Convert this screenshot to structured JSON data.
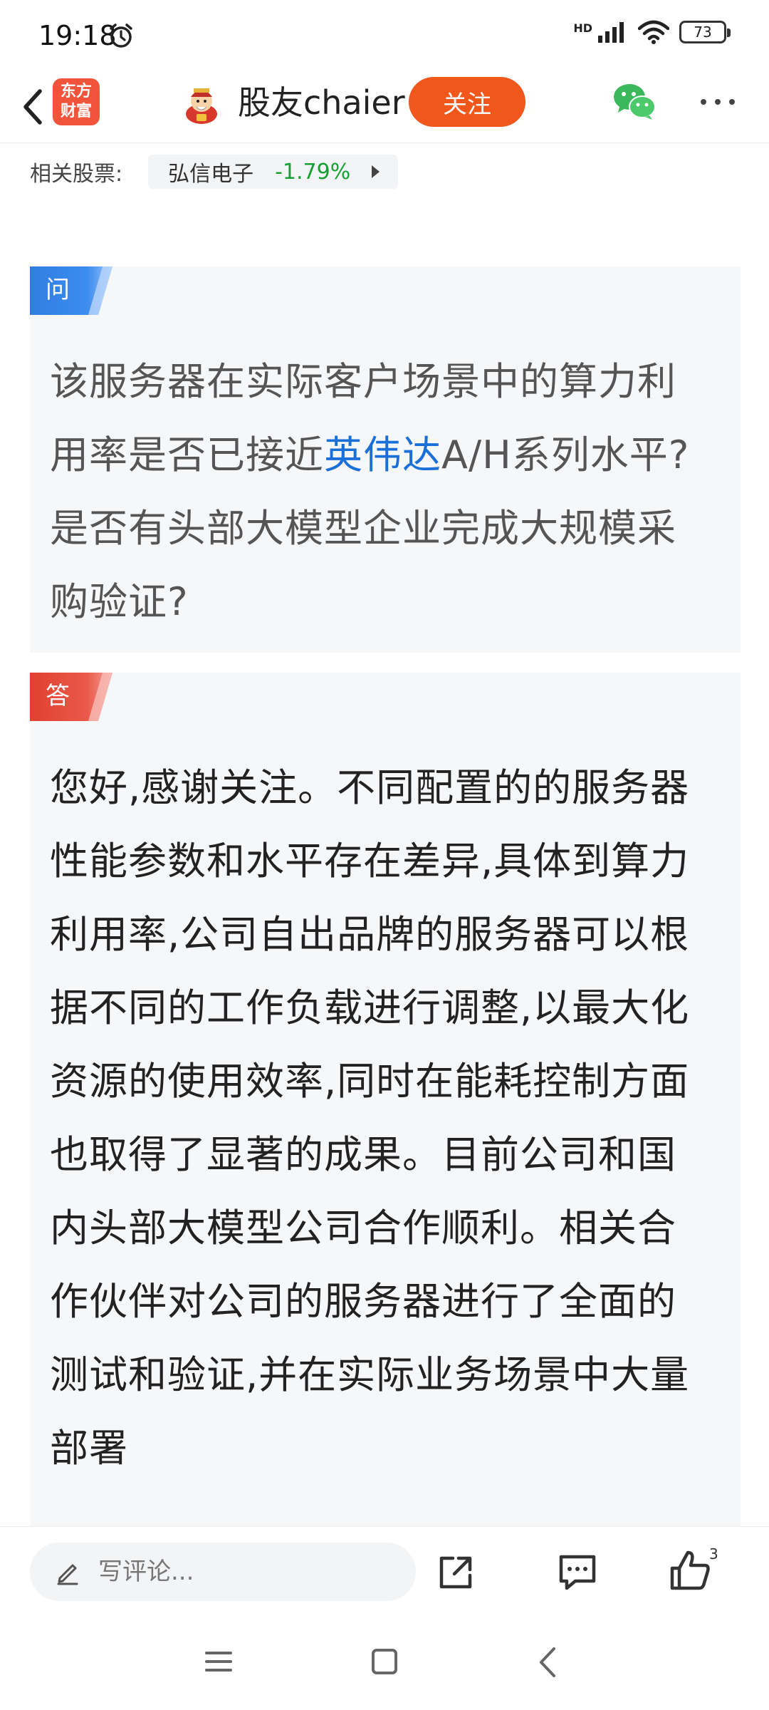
{
  "status_bar": {
    "time": "19:18",
    "network": "HD",
    "battery": "73"
  },
  "header": {
    "app_logo_line1": "东方",
    "app_logo_line2": "财富",
    "username": "股友chaier",
    "follow_label": "关注"
  },
  "related": {
    "label": "相关股票:",
    "stock_name": "弘信电子",
    "stock_change": "-1.79%",
    "change_color": "#19a035"
  },
  "question": {
    "tag": "问",
    "text_before": "该服务器在实际客户场景中的算力利用率是否已接近",
    "highlight": "英伟达",
    "text_after": "A/H系列水平?是否有头部大模型企业完成大规模采购验证?"
  },
  "answer": {
    "tag": "答",
    "text": "您好,感谢关注。不同配置的的服务器性能参数和水平存在差异,具体到算力利用率,公司自出品牌的服务器可以根据不同的工作负载进行调整,以最大化资源的使用效率,同时在能耗控制方面也取得了显著的成果。目前公司和国内头部大模型公司合作顺利。相关合作伙伴对公司的服务器进行了全面的测试和验证,并在实际业务场景中大量部署"
  },
  "bottom_bar": {
    "comment_placeholder": "写评论...",
    "like_count": "3"
  },
  "colors": {
    "accent": "#f1571b",
    "question_tag": "#2f7ee0",
    "answer_tag": "#e24a3b",
    "link": "#1a6fd8"
  },
  "icons": [
    "back-arrow-icon",
    "alarm-clock-icon",
    "signal-icon",
    "wifi-icon",
    "battery-icon",
    "wechat-icon",
    "more-icon",
    "pen-icon",
    "share-icon",
    "comment-icon",
    "thumbs-up-icon",
    "nav-menu-icon",
    "nav-home-icon",
    "nav-back-icon"
  ]
}
